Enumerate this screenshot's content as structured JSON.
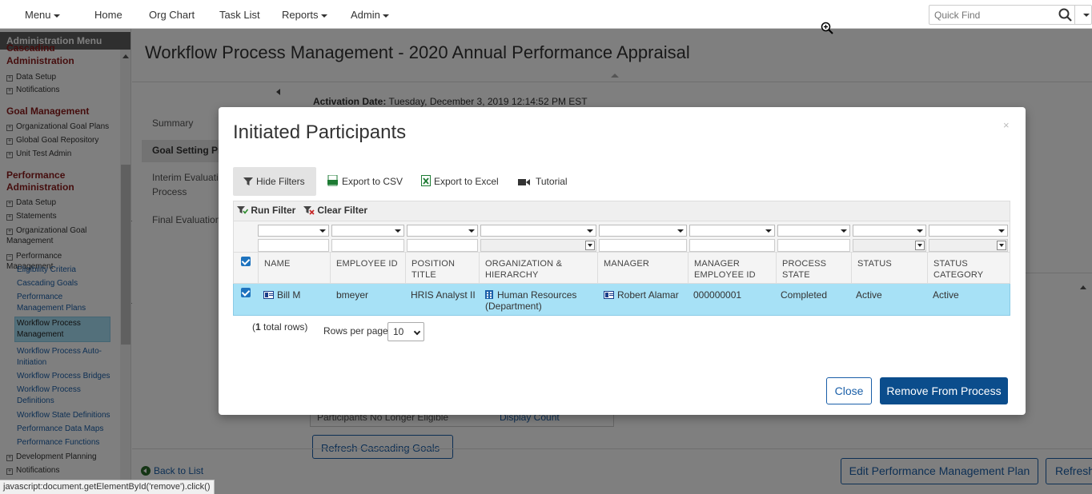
{
  "topnav": {
    "menu": "Menu",
    "home": "Home",
    "org_chart": "Org Chart",
    "task_list": "Task List",
    "reports": "Reports",
    "admin": "Admin",
    "quick_find_placeholder": "Quick Find"
  },
  "sidebar": {
    "title": "Administration Menu",
    "cut_heading": "Cascading",
    "sections": [
      {
        "heading": "Administration"
      },
      {
        "heading": "Goal Management"
      },
      {
        "heading": "Performance Administration"
      }
    ],
    "items": {
      "a_data_setup": "Data Setup",
      "a_notifications": "Notifications",
      "g_org_goal_plans": "Organizational Goal Plans",
      "g_global_goal_repo": "Global Goal Repository",
      "g_unit_test_admin": "Unit Test Admin",
      "p_data_setup": "Data Setup",
      "p_statements": "Statements",
      "p_org_goal_mgmt": "Organizational Goal Management",
      "p_perf_mgmt": "Performance Management",
      "l_eligibility": "Eligibility Criteria",
      "l_cascading_goals": "Cascading Goals",
      "l_pm_plans": "Performance Management Plans",
      "l_wpm": "Workflow Process Management",
      "l_wp_auto": "Workflow Process Auto-Initiation",
      "l_wp_bridges": "Workflow Process Bridges",
      "l_wp_defs": "Workflow Process Definitions",
      "l_wstate_defs": "Workflow State Definitions",
      "l_perf_data_maps": "Performance Data Maps",
      "l_perf_funcs": "Performance Functions",
      "p_dev_planning": "Development Planning",
      "p_notifications": "Notifications"
    }
  },
  "main": {
    "page_title": "Workflow Process Management - 2020 Annual Performance Appraisal",
    "activation_label": "Activation Date:",
    "activation_value": "Tuesday, December 3, 2019 12:14:52 PM EST",
    "subnav": {
      "summary": "Summary",
      "goal_setting": "Goal Setting Pr",
      "interim": "Interim Evaluati Process",
      "final": "Final Evaluation"
    },
    "bg_row_label": "Participants No Longer Eligible",
    "bg_row_link": "Display Count",
    "bg_button": "Refresh Cascading Goals",
    "back_link": "Back to List",
    "edit_pm_button": "Edit Performance Management Plan",
    "refresh_button": "Refresh"
  },
  "status_bar": "javascript:document.getElementById('remove').click()",
  "modal": {
    "title": "Initiated Participants",
    "close_x": "×",
    "toolbar": {
      "hide_filters": "Hide Filters",
      "export_csv": "Export to CSV",
      "export_excel": "Export to Excel",
      "tutorial": "Tutorial"
    },
    "run_filter": "Run Filter",
    "clear_filter": "Clear Filter",
    "columns": [
      "NAME",
      "EMPLOYEE ID",
      "POSITION TITLE",
      "ORGANIZATION & HIERARCHY",
      "MANAGER",
      "MANAGER EMPLOYEE ID",
      "PROCESS STATE",
      "STATUS",
      "STATUS CATEGORY"
    ],
    "rows": [
      {
        "name": "Bill M",
        "employee_id": "bmeyer",
        "position_title": "HRIS Analyst II",
        "organization": "Human Resources (Department)",
        "manager": "Robert Alamar",
        "manager_employee_id": "000000001",
        "process_state": "Completed",
        "status": "Active",
        "status_category": "Active"
      }
    ],
    "total_rows_count": "1",
    "total_rows_suffix": " total rows)",
    "total_rows_prefix": "(",
    "rows_per_page_label": "Rows per page:",
    "rows_per_page_value": "10",
    "close_button": "Close",
    "remove_button": "Remove From Process"
  },
  "colors": {
    "accent": "#1a5fa8",
    "primary_button": "#0b4d8c",
    "selected_row": "#a7e1f6",
    "section_heading": "#8b1a1a"
  }
}
